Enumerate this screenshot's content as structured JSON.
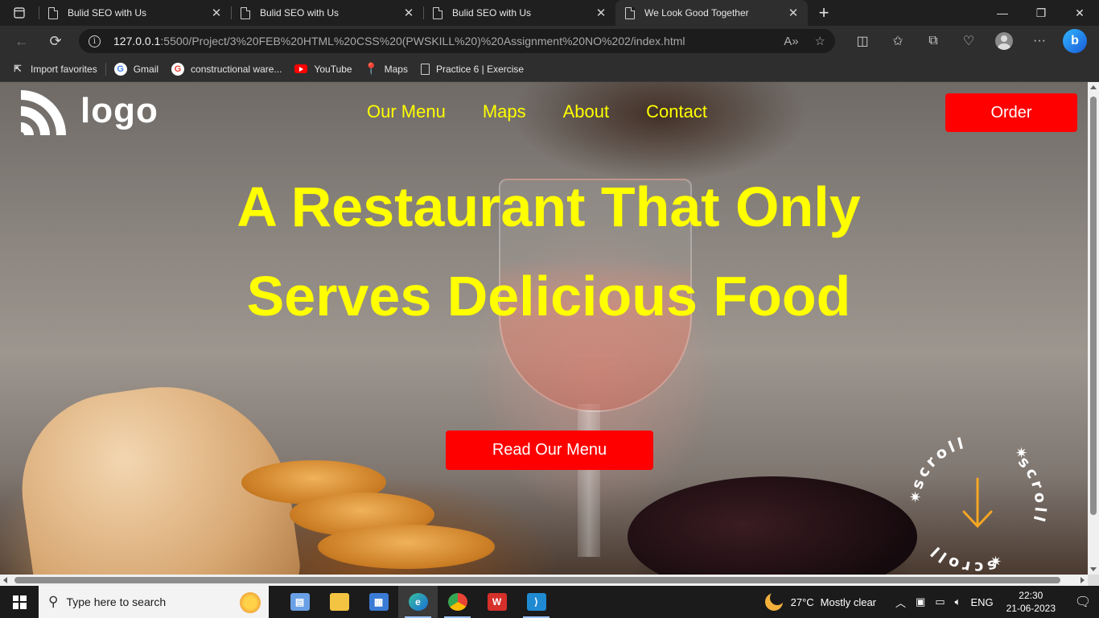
{
  "browser": {
    "tabs": [
      {
        "title": "Bulid SEO with Us",
        "active": false
      },
      {
        "title": "Bulid SEO with Us",
        "active": false
      },
      {
        "title": "Bulid SEO with Us",
        "active": false
      },
      {
        "title": "We Look Good Together",
        "active": true
      }
    ],
    "url_host": "127.0.0.1",
    "url_path": ":5500/Project/3%20FEB%20HTML%20CSS%20(PWSKILL%20)%20Assignment%20NO%202/index.html",
    "favorites": [
      {
        "label": "Import favorites",
        "icon": "import-icon"
      },
      {
        "label": "Gmail",
        "icon": "google-icon"
      },
      {
        "label": "constructional ware...",
        "icon": "google-g-icon"
      },
      {
        "label": "YouTube",
        "icon": "youtube-icon"
      },
      {
        "label": "Maps",
        "icon": "maps-pin-icon"
      },
      {
        "label": "Practice 6 | Exercise",
        "icon": "page-icon"
      }
    ]
  },
  "page": {
    "logo_text": "logo",
    "nav": [
      "Our Menu",
      "Maps",
      "About",
      "Contact"
    ],
    "order_label": "Order",
    "headline": "A Restaurant That Only Serves Delicious Food",
    "cta_label": "Read Our Menu",
    "scroll_word": "scroll",
    "colors": {
      "accent_text": "#ffff00",
      "button": "#ff0000"
    }
  },
  "taskbar": {
    "search_placeholder": "Type here to search",
    "weather_temp": "27°C",
    "weather_desc": "Mostly clear",
    "lang": "ENG",
    "time": "22:30",
    "date": "21-06-2023"
  }
}
